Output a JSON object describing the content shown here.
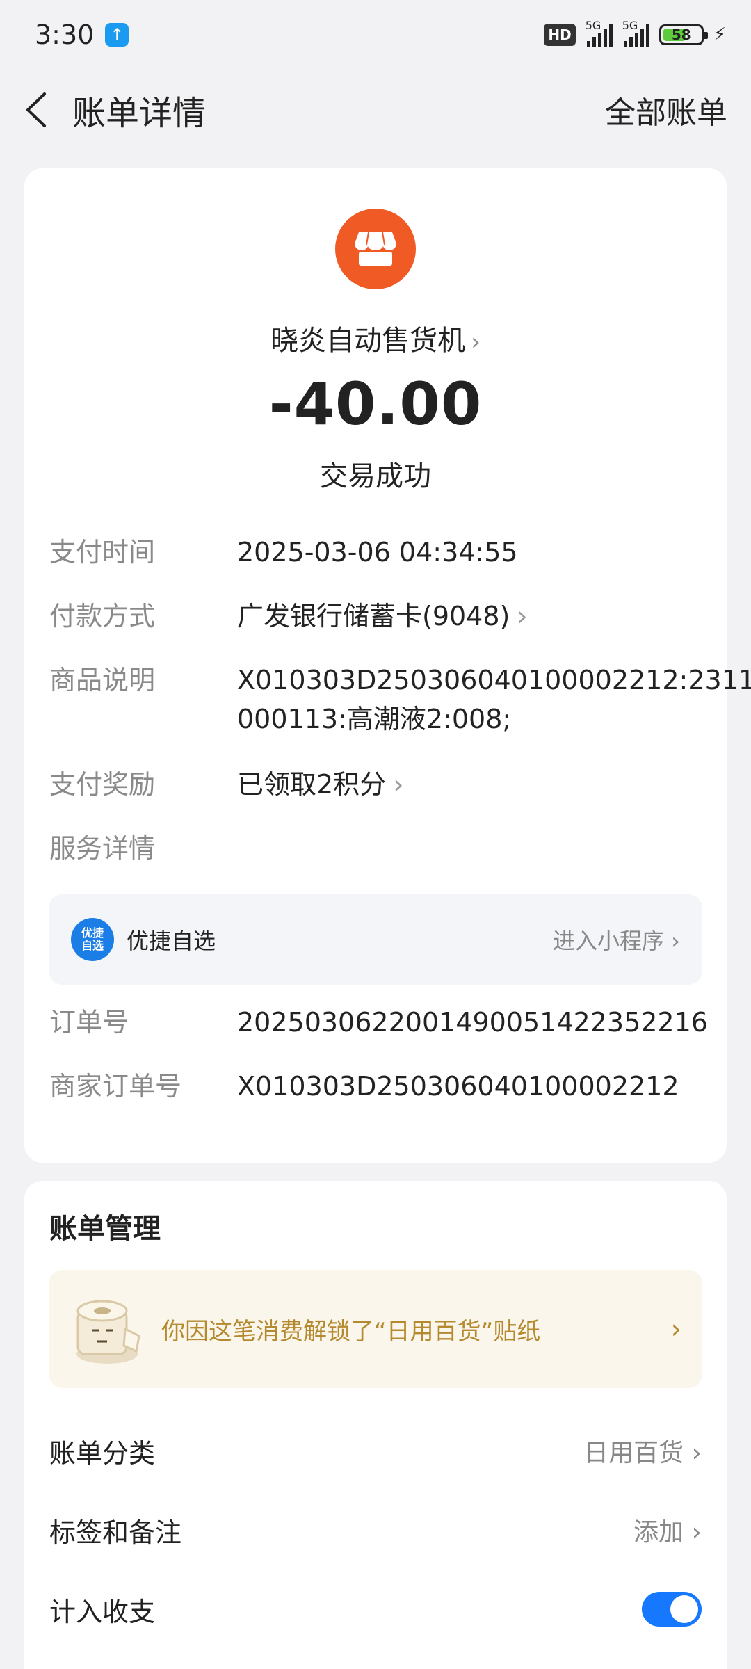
{
  "status": {
    "time": "3:30",
    "network_1": "5G",
    "network_2": "5G",
    "battery": "58",
    "hd": "HD"
  },
  "nav": {
    "title": "账单详情",
    "right_link": "全部账单"
  },
  "merchant": {
    "name": "晓炎自动售货机",
    "amount": "-40.00",
    "status": "交易成功",
    "logo_color": "#f05a24"
  },
  "details": {
    "pay_time_label": "支付时间",
    "pay_time": "2025-03-06 04:34:55",
    "pay_method_label": "付款方式",
    "pay_method": "广发银行储蓄卡(9048)",
    "product_label": "商品说明",
    "product_line1": "X010303D250306040100002212:2311",
    "product_line2": "000113:高潮液2:008;",
    "reward_label": "支付奖励",
    "reward": "已领取2积分",
    "service_label": "服务详情",
    "order_label": "订单号",
    "order_no": "2025030622001490051422352216",
    "merchant_order_label": "商家订单号",
    "merchant_order_no": "X010303D250306040100002212"
  },
  "service": {
    "logo_text_1": "优捷",
    "logo_text_2": "自选",
    "name": "优捷自选",
    "link": "进入小程序"
  },
  "manage": {
    "title": "账单管理",
    "sticker_text": "你因这笔消费解锁了“日用百货”贴纸",
    "category_label": "账单分类",
    "category_value": "日用百货",
    "tag_label": "标签和备注",
    "tag_value": "添加",
    "include_label": "计入收支",
    "include_on": true,
    "toggle_color": "#1677ff"
  }
}
